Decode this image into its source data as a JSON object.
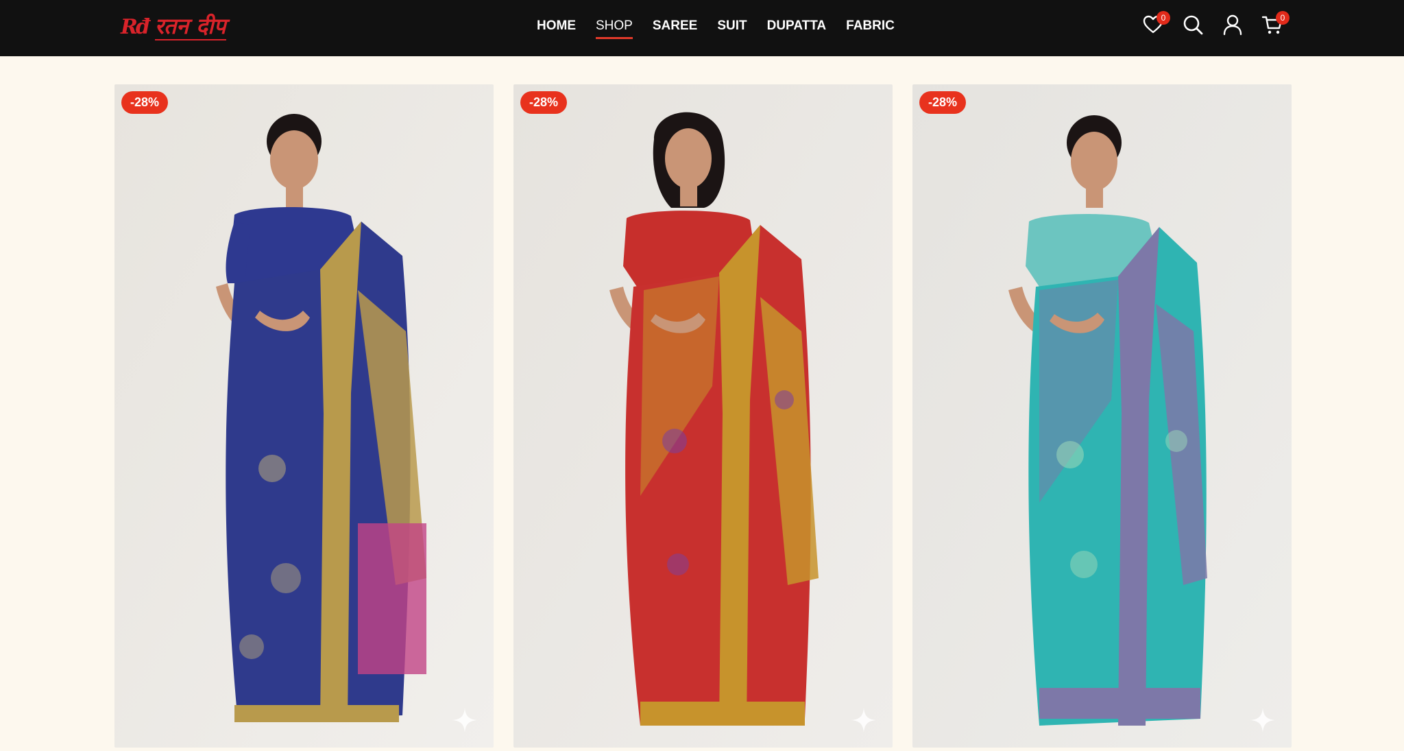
{
  "brand": {
    "mark": "Rđ",
    "name": "रतन दीप"
  },
  "nav": [
    {
      "label": "HOME",
      "active": false
    },
    {
      "label": "SHOP",
      "active": true
    },
    {
      "label": "SAREE",
      "active": false
    },
    {
      "label": "SUIT",
      "active": false
    },
    {
      "label": "DUPATTA",
      "active": false
    },
    {
      "label": "FABRIC",
      "active": false
    }
  ],
  "header_icons": {
    "wishlist": {
      "icon": "heart-icon",
      "count": "0"
    },
    "search": {
      "icon": "search-icon"
    },
    "account": {
      "icon": "user-icon"
    },
    "cart": {
      "icon": "cart-icon",
      "count": "0"
    }
  },
  "products": [
    {
      "discount": "-28%",
      "saree_color": "#2f3a8c",
      "border_color": "#b89a4c",
      "blouse_color": "#2e3990"
    },
    {
      "discount": "-28%",
      "saree_color": "#c8302e",
      "border_color": "#c7932c",
      "blouse_color": "#c72f2c"
    },
    {
      "discount": "-28%",
      "saree_color": "#2fb4b2",
      "border_color": "#7d78a8",
      "blouse_color": "#6cc5c0"
    }
  ],
  "colors": {
    "header_bg": "#111111",
    "page_bg": "#fdf8ee",
    "accent": "#e23a2a"
  }
}
